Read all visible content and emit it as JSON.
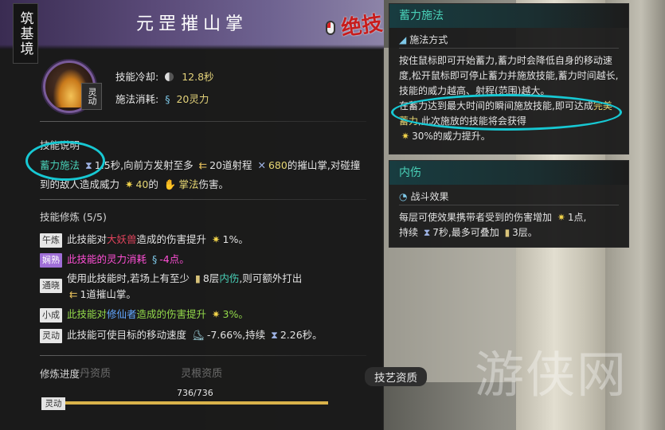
{
  "background": {
    "watermark": "游侠网"
  },
  "tooltip": {
    "realm": "筑基境",
    "title": "元罡摧山掌",
    "ultimate_label": "绝技",
    "skill_tag": "灵动",
    "cooldown_label": "技能冷却:",
    "cooldown_value": "12.8秒",
    "cost_label": "施法消耗:",
    "cost_value": "20灵力",
    "desc_title": "技能说明",
    "desc": {
      "kw": "蓄力施法",
      "t1": "1.5秒,向前方发射至多",
      "t2": "20道射程",
      "t3": "680",
      "t4": "的摧山掌,对碰撞到的敌人造成威力",
      "t5": "40",
      "t6": "的",
      "t7": "掌法",
      "t8": "伤害。"
    },
    "cult_title": "技能修炼 (5/5)",
    "cult": {
      "r1_tag": "午炼",
      "r1_a": "此技能对",
      "r1_b": "大妖兽",
      "r1_c": "造成的伤害提升",
      "r1_d": "1%。",
      "r2_tag": "娴熟",
      "r2_a": "此技能的灵力消耗",
      "r2_b": "-4点。",
      "r3_tag": "通晓",
      "r3_a": "使用此技能时,若场上有至少",
      "r3_b": "8层",
      "r3_c": "内伤",
      "r3_d": ",则可额外打出",
      "r3_e": "1道摧山掌。",
      "r4_tag": "小成",
      "r4_a": "此技能对",
      "r4_b": "修仙者",
      "r4_c": "造成的伤害提升",
      "r4_d": "3%。",
      "r5_tag": "灵动",
      "r5_a": "此技能可使目标的移动速度",
      "r5_b": "-7.66%,持续",
      "r5_c": "2.26秒。"
    },
    "progress_title": "修炼进度",
    "progress_text": "736/736",
    "progress_fraction": 1.0,
    "bar_tag": "灵动",
    "bg_tabs": [
      "丹资质",
      "灵根资质"
    ],
    "tech_tab": "技艺资质"
  },
  "charge_panel": {
    "title": "蓄力施法",
    "sub": "施法方式",
    "p1": "按住鼠标即可开始蓄力,蓄力时会降低自身的移动速度,松开鼠标即可停止蓄力并施放技能,蓄力时间越长,技能的威力越高、射程(范围)越大。",
    "p2a": "在蓄力达到最大时间的瞬间施放技能,即可达成",
    "p2b": "完美蓄力",
    "p2c": ",此次施放的技能将会获得",
    "p2d": "30%的威力提升。"
  },
  "injury_panel": {
    "title": "内伤",
    "sub": "战斗效果",
    "a": "每层可使效果携带者受到的伤害增加",
    "b": "1点,",
    "c": "持续",
    "d": "7秒,最多可叠加",
    "e": "3层。"
  },
  "colors": {
    "accent_teal": "#49d1b8",
    "value_yellow": "#e6d673",
    "annotation_cyan": "#17c8d3",
    "ultimate_red": "#c71c1c"
  }
}
